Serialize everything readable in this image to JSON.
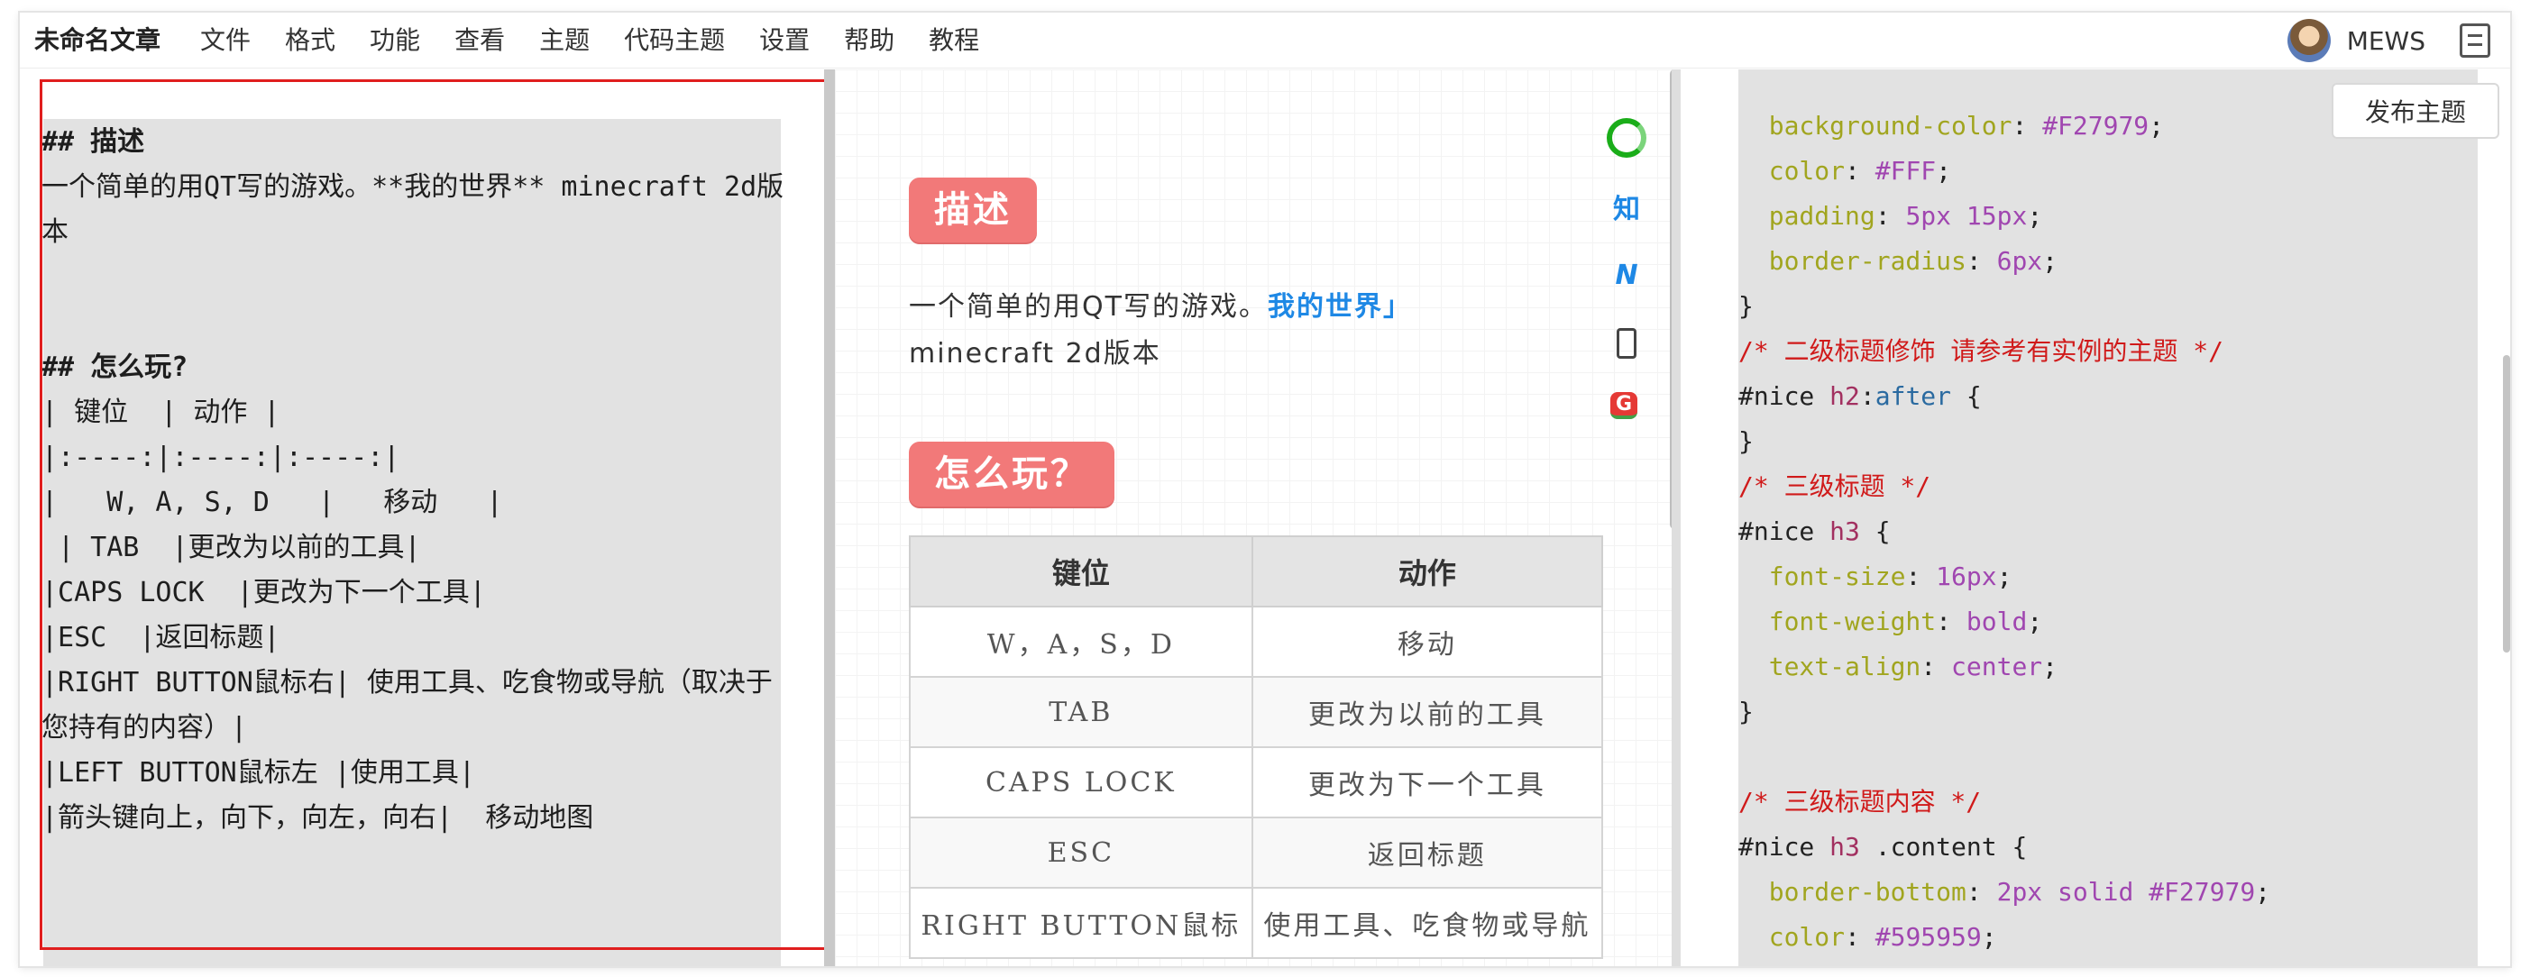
{
  "menubar": {
    "doc_title": "未命名文章",
    "items": [
      "文件",
      "格式",
      "功能",
      "查看",
      "主题",
      "代码主题",
      "设置",
      "帮助",
      "教程"
    ],
    "username": "MEWS"
  },
  "editor": {
    "lines": [
      {
        "text": "## 描述",
        "bold": true
      },
      {
        "text": "一个简单的用QT写的游戏。**我的世界** minecraft 2d版本",
        "bold": false
      },
      {
        "text": "",
        "bold": false
      },
      {
        "text": "",
        "bold": false
      },
      {
        "text": "## 怎么玩?",
        "bold": true
      },
      {
        "text": "| 键位  | 动作 |",
        "bold": false
      },
      {
        "text": "|:----:|:----:|:----:|",
        "bold": false
      },
      {
        "text": "|   W, A, S, D   |   移动   |",
        "bold": false
      },
      {
        "text": " | TAB  |更改为以前的工具|",
        "bold": false
      },
      {
        "text": "|CAPS LOCK  |更改为下一个工具|",
        "bold": false
      },
      {
        "text": "|ESC  |返回标题|",
        "bold": false
      },
      {
        "text": "|RIGHT BUTTON鼠标右| 使用工具、吃食物或导航（取决于您持有的内容）|",
        "bold": false
      },
      {
        "text": "|LEFT BUTTON鼠标左 |使用工具|",
        "bold": false
      },
      {
        "text": "|箭头键向上，向下，向左，向右|  移动地图",
        "bold": false
      }
    ]
  },
  "preview": {
    "h2_desc": "描述",
    "para_prefix": "一个简单的用QT写的游戏。",
    "para_link": "我的世界」",
    "para_suffix": "minecraft 2d版本",
    "h2_howto": "怎么玩？",
    "table": {
      "headers": [
        "键位",
        "动作"
      ],
      "rows": [
        [
          "W，A，S，D",
          "移动"
        ],
        [
          "TAB",
          "更改为以前的工具"
        ],
        [
          "CAPS LOCK",
          "更改为下一个工具"
        ],
        [
          "ESC",
          "返回标题"
        ],
        [
          "RIGHT BUTTON鼠标",
          "使用工具、吃食物或导航"
        ]
      ]
    },
    "side_icons": [
      "wechat-icon",
      "zhihu-icon",
      "juejin-icon",
      "phone-icon",
      "google-icon"
    ],
    "zhihu_label": "知",
    "juejin_label": "N",
    "google_label": "G"
  },
  "css_editor": {
    "publish_label": "发布主题",
    "lines": [
      [
        {
          "t": "  "
        },
        {
          "t": "background-color",
          "c": "prop"
        },
        {
          "t": ": "
        },
        {
          "t": "#F27979",
          "c": "val"
        },
        {
          "t": ";"
        }
      ],
      [
        {
          "t": "  "
        },
        {
          "t": "color",
          "c": "prop"
        },
        {
          "t": ": "
        },
        {
          "t": "#FFF",
          "c": "val"
        },
        {
          "t": ";"
        }
      ],
      [
        {
          "t": "  "
        },
        {
          "t": "padding",
          "c": "prop"
        },
        {
          "t": ": "
        },
        {
          "t": "5px 15px",
          "c": "val"
        },
        {
          "t": ";"
        }
      ],
      [
        {
          "t": "  "
        },
        {
          "t": "border-radius",
          "c": "prop"
        },
        {
          "t": ": "
        },
        {
          "t": "6px",
          "c": "val"
        },
        {
          "t": ";"
        }
      ],
      [
        {
          "t": "}"
        }
      ],
      [
        {
          "t": "/* 二级标题修饰 请参考有实例的主题 */",
          "c": "comment"
        }
      ],
      [
        {
          "t": "#nice "
        },
        {
          "t": "h2",
          "c": "tag"
        },
        {
          "t": ":"
        },
        {
          "t": "after",
          "c": "pseudo"
        },
        {
          "t": " {"
        }
      ],
      [
        {
          "t": "}"
        }
      ],
      [
        {
          "t": "/* 三级标题 */",
          "c": "comment"
        }
      ],
      [
        {
          "t": "#nice "
        },
        {
          "t": "h3",
          "c": "tag"
        },
        {
          "t": " {"
        }
      ],
      [
        {
          "t": "  "
        },
        {
          "t": "font-size",
          "c": "prop"
        },
        {
          "t": ": "
        },
        {
          "t": "16px",
          "c": "val"
        },
        {
          "t": ";"
        }
      ],
      [
        {
          "t": "  "
        },
        {
          "t": "font-weight",
          "c": "prop"
        },
        {
          "t": ": "
        },
        {
          "t": "bold",
          "c": "val"
        },
        {
          "t": ";"
        }
      ],
      [
        {
          "t": "  "
        },
        {
          "t": "text-align",
          "c": "prop"
        },
        {
          "t": ": "
        },
        {
          "t": "center",
          "c": "val"
        },
        {
          "t": ";"
        }
      ],
      [
        {
          "t": "}"
        }
      ],
      [],
      [
        {
          "t": "/* 三级标题内容 */",
          "c": "comment"
        }
      ],
      [
        {
          "t": "#nice "
        },
        {
          "t": "h3",
          "c": "tag"
        },
        {
          "t": " .content {"
        }
      ],
      [
        {
          "t": "  "
        },
        {
          "t": "border-bottom",
          "c": "prop"
        },
        {
          "t": ": "
        },
        {
          "t": "2px solid #F27979",
          "c": "val"
        },
        {
          "t": ";"
        }
      ],
      [
        {
          "t": "  "
        },
        {
          "t": "color",
          "c": "prop"
        },
        {
          "t": ": "
        },
        {
          "t": "#595959",
          "c": "val"
        },
        {
          "t": ";"
        }
      ]
    ]
  },
  "colors": {
    "accent": "#F27979",
    "link": "#1e88e5",
    "highlight_box": "#e01e1e"
  }
}
